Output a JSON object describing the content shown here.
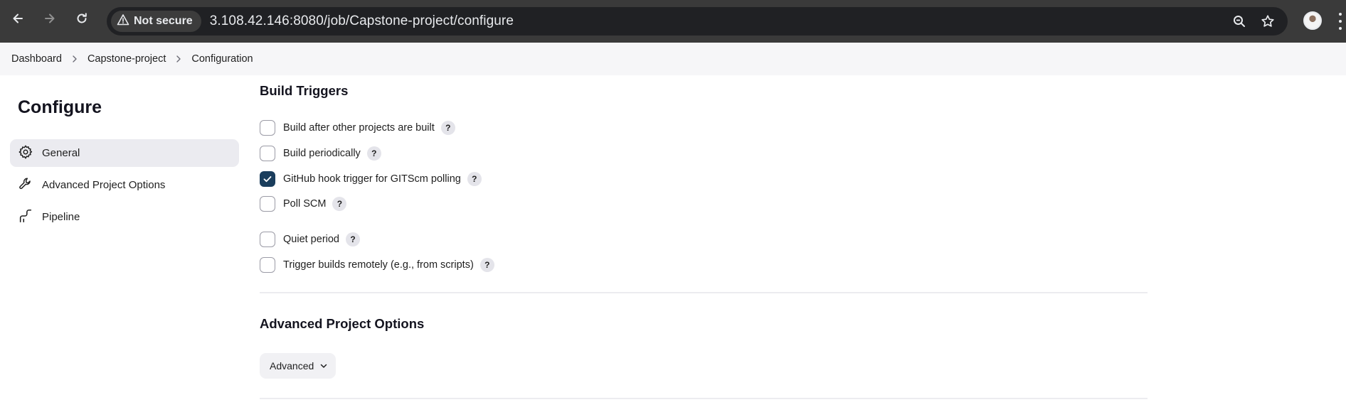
{
  "browser": {
    "security_label": "Not secure",
    "url": "3.108.42.146:8080/job/Capstone-project/configure",
    "icons": [
      "back-arrow-icon",
      "forward-arrow-icon",
      "reload-icon",
      "warning-icon",
      "zoom-icon",
      "star-icon",
      "profile-avatar",
      "more-menu-icon"
    ]
  },
  "breadcrumb": {
    "items": [
      "Dashboard",
      "Capstone-project",
      "Configuration"
    ]
  },
  "sidebar": {
    "heading": "Configure",
    "items": [
      {
        "label": "General",
        "icon": "gear-icon",
        "active": true
      },
      {
        "label": "Advanced Project Options",
        "icon": "wrench-icon",
        "active": false
      },
      {
        "label": "Pipeline",
        "icon": "pipeline-icon",
        "active": false
      }
    ]
  },
  "build_triggers": {
    "title": "Build Triggers",
    "options": [
      {
        "label": "Build after other projects are built",
        "checked": false,
        "help": "?"
      },
      {
        "label": "Build periodically",
        "checked": false,
        "help": "?"
      },
      {
        "label": "GitHub hook trigger for GITScm polling",
        "checked": true,
        "help": "?"
      },
      {
        "label": "Poll SCM",
        "checked": false,
        "help": "?"
      },
      {
        "label": "Quiet period",
        "checked": false,
        "help": "?"
      },
      {
        "label": "Trigger builds remotely (e.g., from scripts)",
        "checked": false,
        "help": "?"
      }
    ]
  },
  "advanced_options": {
    "title": "Advanced Project Options",
    "button_label": "Advanced"
  },
  "colors": {
    "chrome_bg": "#3a3a3a",
    "omnibox_bg": "#202124",
    "checkbox_checked": "#1a3d5c",
    "active_sidebar_bg": "#ebebf0"
  }
}
